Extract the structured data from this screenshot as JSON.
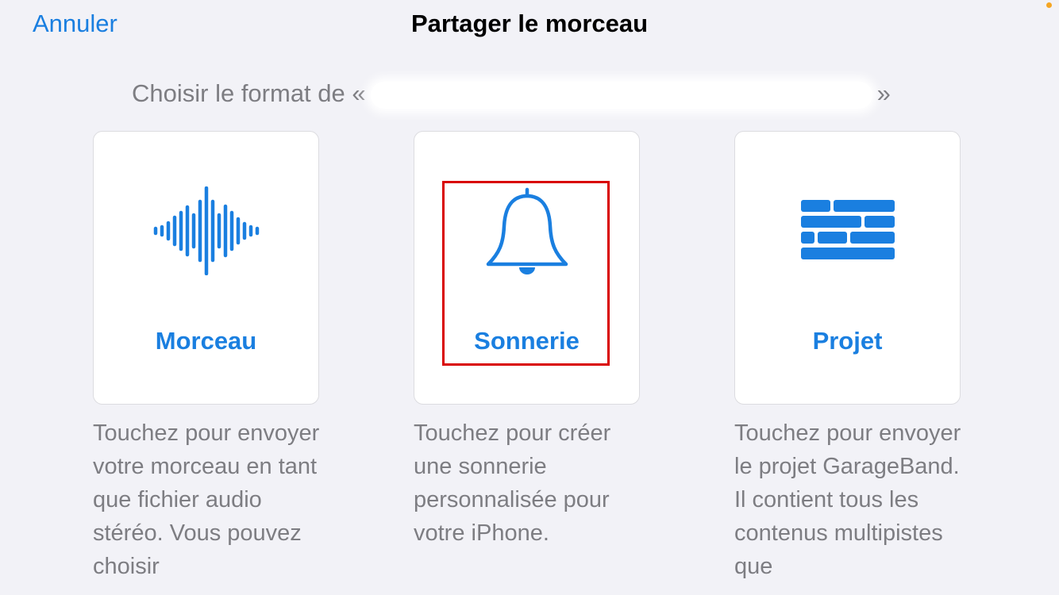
{
  "nav": {
    "cancel_label": "Annuler",
    "title": "Partager le morceau"
  },
  "subtitle": {
    "prefix": "Choisir le format de «",
    "suffix": "»"
  },
  "options": [
    {
      "label": "Morceau",
      "icon": "waveform-icon",
      "description": "Touchez pour envoyer votre morceau en tant que fichier audio stéréo. Vous pouvez choisir"
    },
    {
      "label": "Sonnerie",
      "icon": "bell-icon",
      "description": "Touchez pour créer une sonnerie personnalisée pour votre iPhone."
    },
    {
      "label": "Projet",
      "icon": "bricks-icon",
      "description": "Touchez pour envoyer le projet GarageBand. Il contient tous les contenus multipistes que"
    }
  ],
  "colors": {
    "accent": "#1a7fe0",
    "background": "#f2f2f7",
    "highlight": "#d90000",
    "secondary_text": "#7d7d82",
    "status_dot": "#f5a623"
  }
}
